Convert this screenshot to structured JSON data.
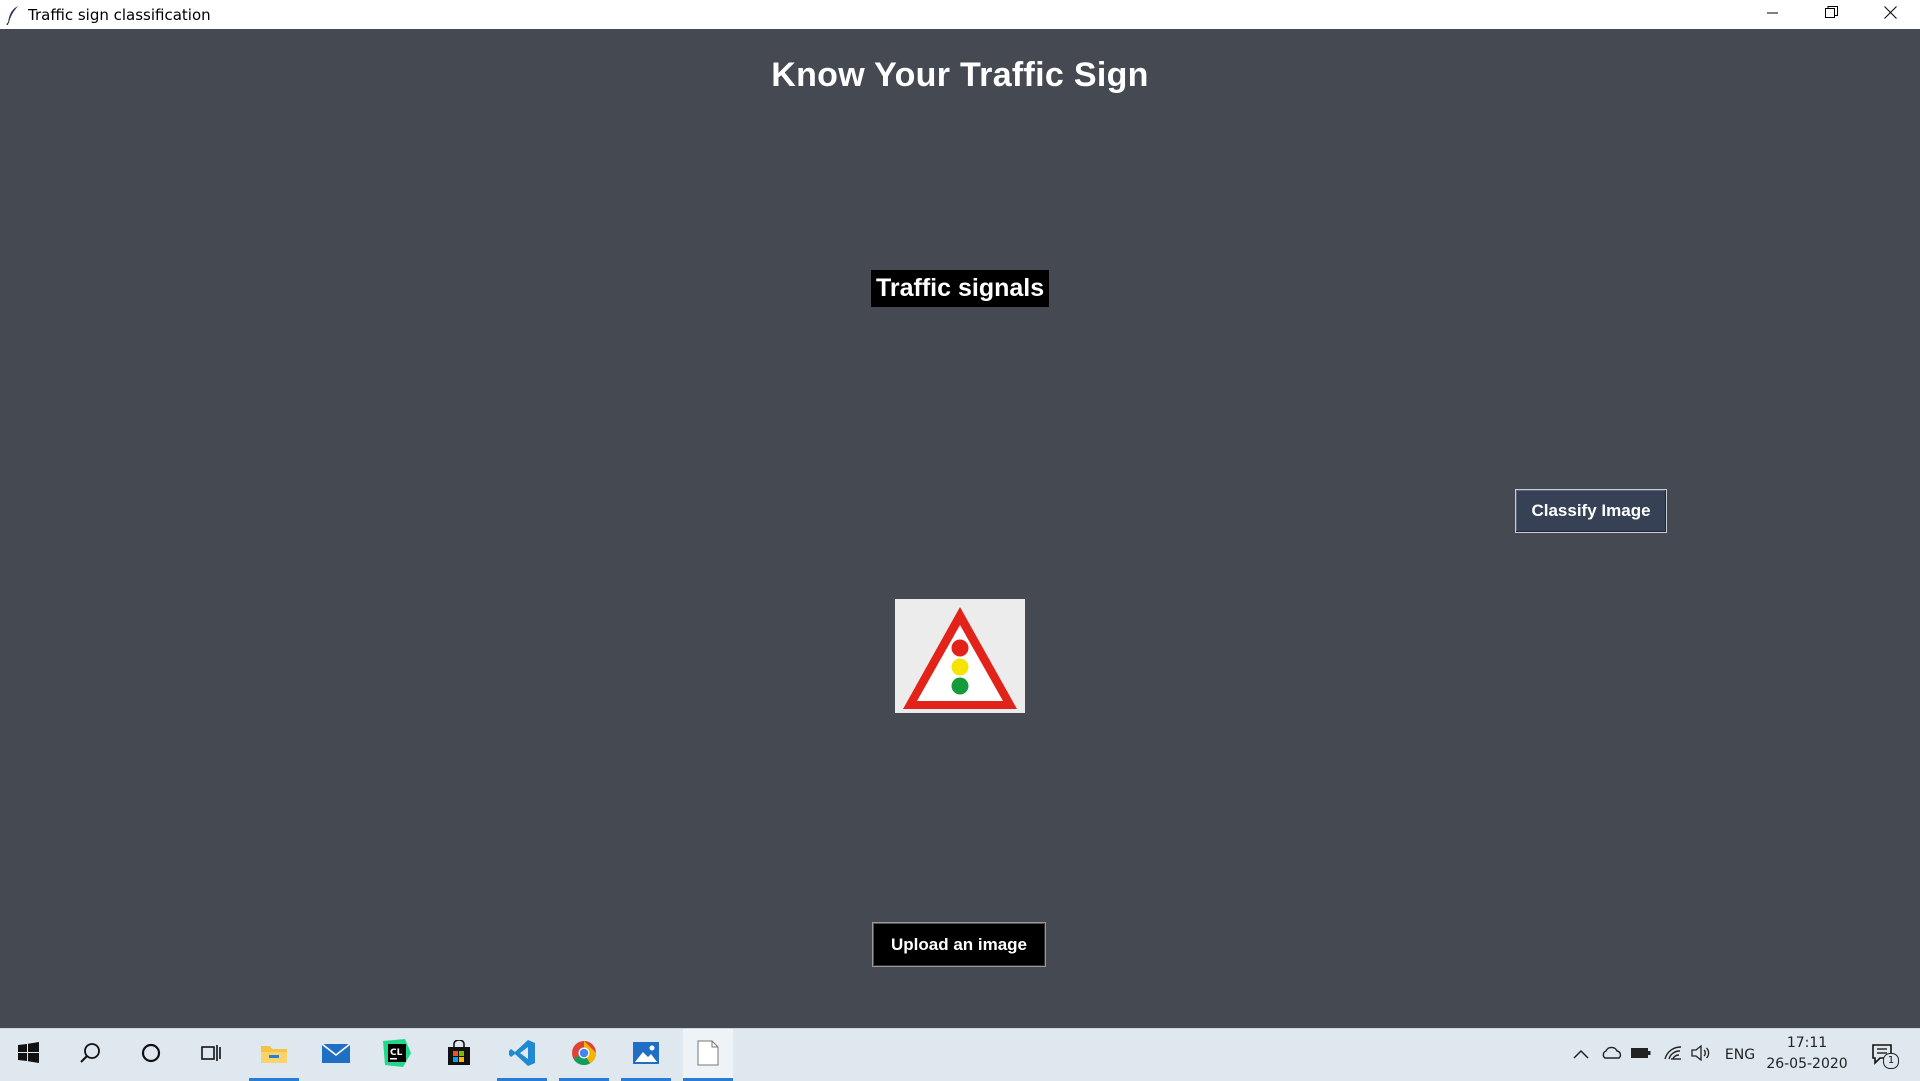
{
  "window": {
    "title": "Traffic sign classification",
    "icon": "feather-icon",
    "controls": [
      "minimize-icon",
      "restore-icon",
      "close-icon"
    ]
  },
  "app": {
    "heading": "Know Your Traffic Sign",
    "result_label": "Traffic signals",
    "classify_button": "Classify Image",
    "upload_button": "Upload an image",
    "uploaded_image": "traffic-signals-warning-sign",
    "background_color": "#454a52",
    "classify_button_color": "#364156"
  },
  "taskbar": {
    "apps": [
      "windows-start-icon",
      "search-icon",
      "cortana-icon",
      "task-view-icon",
      "file-explorer-icon",
      "mail-icon",
      "clion-icon",
      "store-icon",
      "vscode-icon",
      "chrome-icon",
      "photos-icon",
      "notepad-icon"
    ],
    "tray": {
      "icons": [
        "chevron-up-icon",
        "onedrive-icon",
        "battery-icon",
        "wifi-icon",
        "volume-icon"
      ],
      "language": "ENG",
      "time": "17:11",
      "date": "26-05-2020",
      "notification_count": "1"
    }
  }
}
